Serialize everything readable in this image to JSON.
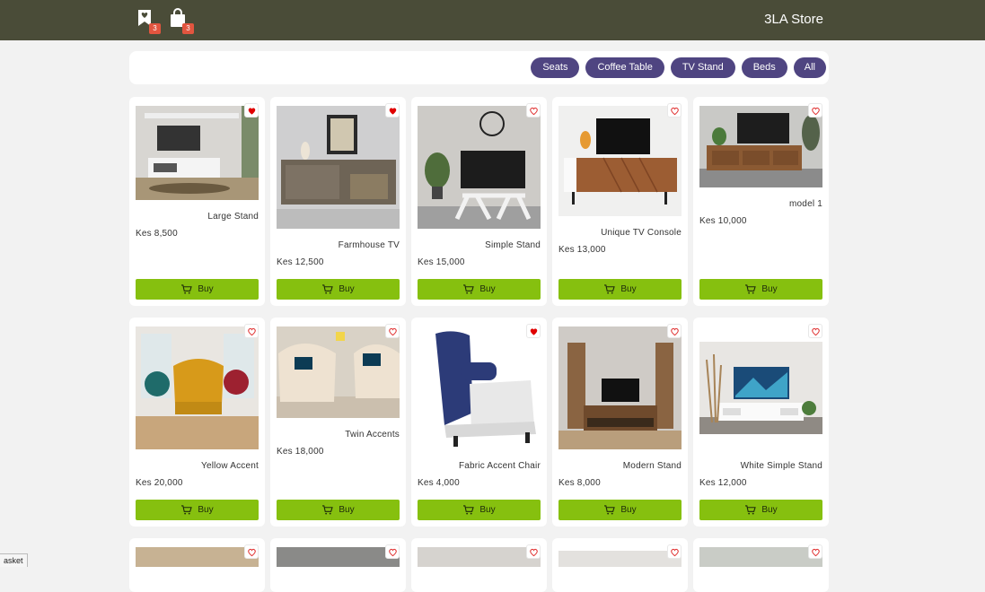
{
  "header": {
    "store_name": "3LA Store",
    "wishlist_count": "3",
    "cart_count": "3",
    "wishlist_icon": "bookmark-heart-icon",
    "cart_icon": "shopping-bag-icon"
  },
  "filters": [
    "Seats",
    "Coffee Table",
    "TV Stand",
    "Beds",
    "All"
  ],
  "buy_label": "Buy",
  "products": [
    {
      "name": "Large Stand",
      "price": "Kes 8,500",
      "liked": true
    },
    {
      "name": "Farmhouse TV",
      "price": "Kes 12,500",
      "liked": true
    },
    {
      "name": "Simple Stand",
      "price": "Kes 15,000",
      "liked": false
    },
    {
      "name": "Unique TV Console",
      "price": "Kes 13,000",
      "liked": false
    },
    {
      "name": "model 1",
      "price": "Kes 10,000",
      "liked": false
    },
    {
      "name": "Yellow Accent",
      "price": "Kes 20,000",
      "liked": false
    },
    {
      "name": "Twin Accents",
      "price": "Kes 18,000",
      "liked": false
    },
    {
      "name": "Fabric Accent Chair",
      "price": "Kes 4,000",
      "liked": true
    },
    {
      "name": "Modern Stand",
      "price": "Kes 8,000",
      "liked": false
    },
    {
      "name": "White Simple Stand",
      "price": "Kes 12,000",
      "liked": false
    }
  ],
  "status_text": "asket",
  "colors": {
    "header": "#4a4c38",
    "pill": "#4f4581",
    "buy": "#86c00f",
    "heart": "#e00000",
    "badge": "#e2553f"
  }
}
